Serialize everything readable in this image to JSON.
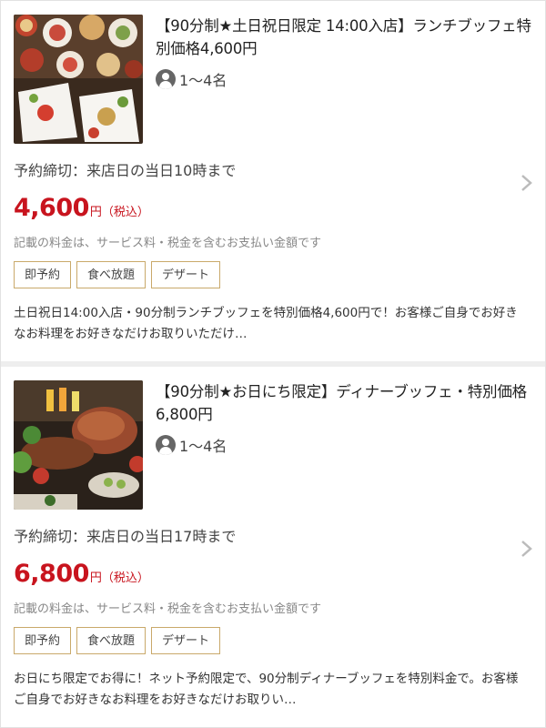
{
  "plans": [
    {
      "title": "【90分制★土日祝日限定 14:00入店】ランチブッフェ特別価格4,600円",
      "capacity": "1〜4名",
      "deadline": "予約締切：来店日の当日10時まで",
      "price": "4,600",
      "price_unit": "円（税込）",
      "note": "記載の料金は、サービス料・税金を含むお支払い金額です",
      "tags": [
        "即予約",
        "食べ放題",
        "デザート"
      ],
      "description": "土日祝日14:00入店・90分制ランチブッフェを特別価格4,600円で！お客様ご自身でお好きなお料理をお好きなだけお取りいただけ…",
      "image_icon": "lunch-buffet-photo"
    },
    {
      "title": "【90分制★お日にち限定】ディナーブッフェ・特別価格6,800円",
      "capacity": "1〜4名",
      "deadline": "予約締切：来店日の当日17時まで",
      "price": "6,800",
      "price_unit": "円（税込）",
      "note": "記載の料金は、サービス料・税金を含むお支払い金額です",
      "tags": [
        "即予約",
        "食べ放題",
        "デザート"
      ],
      "description": "お日にち限定でお得に！ネット予約限定で、90分制ディナーブッフェを特別料金で。お客様ご自身でお好きなお料理をお好きなだけお取りい…",
      "image_icon": "dinner-buffet-photo"
    }
  ],
  "colors": {
    "price": "#c8141e",
    "tag_border": "#c9a96a",
    "note": "#888888"
  }
}
